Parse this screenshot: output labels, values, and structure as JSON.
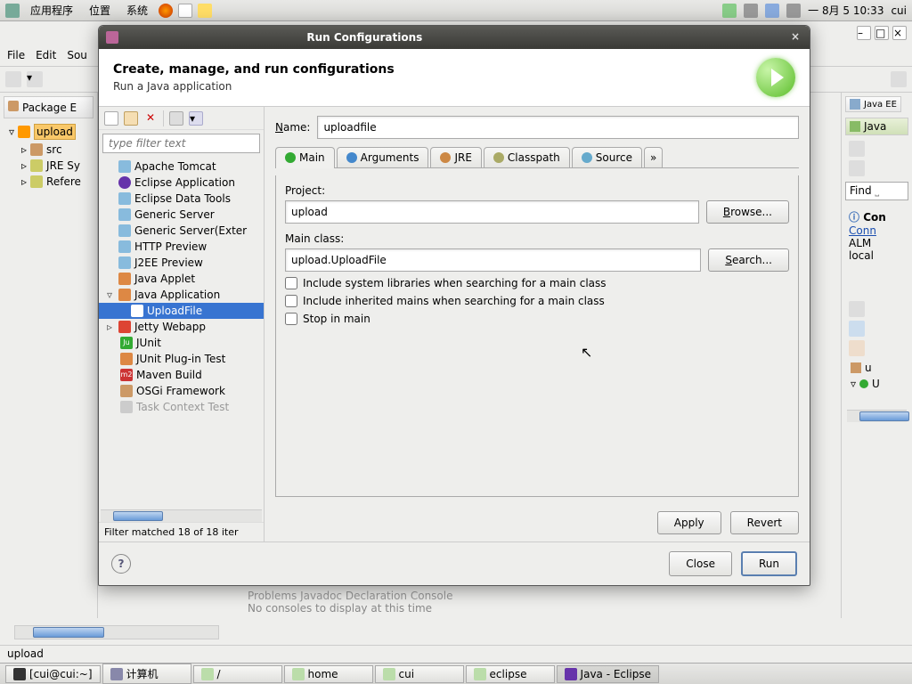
{
  "gnome": {
    "apps": "应用程序",
    "places": "位置",
    "system": "系统",
    "clock": "一 8月  5 10:33",
    "user": "cui"
  },
  "eclipse": {
    "menu": {
      "file": "File",
      "edit": "Edit",
      "source": "Sou"
    },
    "pkgexp_title": "Package E",
    "project": "upload",
    "src": "src",
    "jre": "JRE Sy",
    "ref": "Refere",
    "persp_javaee": "Java EE",
    "persp_java": "Java",
    "find": "Find",
    "conn_title": "Con",
    "conn_link": "Conn",
    "conn_l1": "ALM",
    "conn_l2": "local",
    "outline_u1": "u",
    "outline_u2": "U",
    "console_tabs": "Problems    Javadoc    Declaration    Console",
    "console_msg": "No consoles to display at this time",
    "status": "upload"
  },
  "dialog": {
    "title": "Run Configurations",
    "heading": "Create, manage, and run configurations",
    "sub": "Run a Java application",
    "filter_placeholder": "type filter text",
    "tree": {
      "tomcat": "Apache Tomcat",
      "eclipseapp": "Eclipse Application",
      "datatools": "Eclipse Data Tools",
      "genserver": "Generic Server",
      "genserverext": "Generic Server(Exter",
      "httpprev": "HTTP Preview",
      "j2ee": "J2EE Preview",
      "applet": "Java Applet",
      "javaapp": "Java Application",
      "uploadfile": "UploadFile",
      "jetty": "Jetty Webapp",
      "junit": "JUnit",
      "junitplug": "JUnit Plug-in Test",
      "maven": "Maven Build",
      "osgi": "OSGi Framework",
      "task": "Task Context Test"
    },
    "tree_status": "Filter matched 18 of 18 iter",
    "name_label": "Name:",
    "name_value": "uploadfile",
    "tabs": {
      "main": "Main",
      "args": "Arguments",
      "jre": "JRE",
      "cp": "Classpath",
      "src": "Source",
      "more": "»"
    },
    "project_label": "Project:",
    "project_value": "upload",
    "browse": "Browse...",
    "mainclass_label": "Main class:",
    "mainclass_value": "upload.UploadFile",
    "search": "Search...",
    "chk1": "Include system libraries when searching for a main class",
    "chk2": "Include inherited mains when searching for a main class",
    "chk3": "Stop in main",
    "apply": "Apply",
    "revert": "Revert",
    "close": "Close",
    "run": "Run"
  },
  "taskbar": {
    "t1": "[cui@cui:~]",
    "t2": "计算机",
    "t3": "/",
    "t4": "home",
    "t5": "cui",
    "t6": "eclipse",
    "t7": "Java - Eclipse"
  }
}
